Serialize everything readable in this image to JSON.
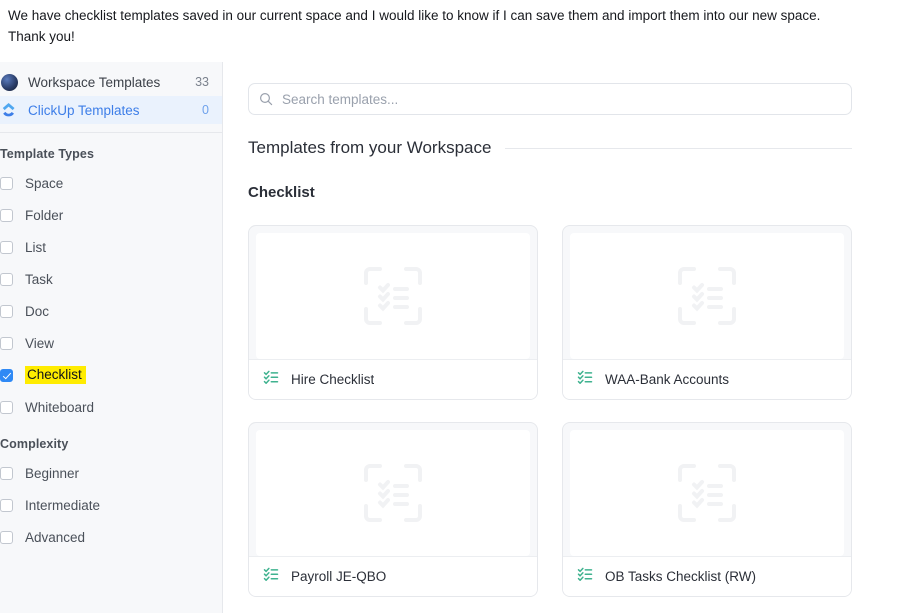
{
  "intro": {
    "line1": "We have checklist templates saved in our current space and I would like to know if I can save them and import them into our new space.",
    "line2": "Thank you!"
  },
  "sidebar": {
    "nav": [
      {
        "label": "Workspace Templates",
        "count": "33",
        "icon": "avatar-icon",
        "active": false
      },
      {
        "label": "ClickUp Templates",
        "count": "0",
        "icon": "clickup-logo-icon",
        "active": true
      }
    ],
    "sections": [
      {
        "title": "Template Types",
        "options": [
          {
            "label": "Space",
            "checked": false,
            "highlighted": false
          },
          {
            "label": "Folder",
            "checked": false,
            "highlighted": false
          },
          {
            "label": "List",
            "checked": false,
            "highlighted": false
          },
          {
            "label": "Task",
            "checked": false,
            "highlighted": false
          },
          {
            "label": "Doc",
            "checked": false,
            "highlighted": false
          },
          {
            "label": "View",
            "checked": false,
            "highlighted": false
          },
          {
            "label": "Checklist",
            "checked": true,
            "highlighted": true
          },
          {
            "label": "Whiteboard",
            "checked": false,
            "highlighted": false
          }
        ]
      },
      {
        "title": "Complexity",
        "options": [
          {
            "label": "Beginner",
            "checked": false,
            "highlighted": false
          },
          {
            "label": "Intermediate",
            "checked": false,
            "highlighted": false
          },
          {
            "label": "Advanced",
            "checked": false,
            "highlighted": false
          }
        ]
      }
    ]
  },
  "main": {
    "search": {
      "value": "",
      "placeholder": "Search templates..."
    },
    "workspace_section_title": "Templates from your Workspace",
    "category_title": "Checklist",
    "cards": [
      {
        "name": "Hire Checklist"
      },
      {
        "name": "WAA-Bank Accounts"
      },
      {
        "name": "Payroll JE-QBO"
      },
      {
        "name": "OB Tasks Checklist (RW)"
      }
    ]
  },
  "colors": {
    "accent_blue": "#2f89f5",
    "active_blue": "#3d7ee8",
    "highlight_yellow": "#ffec00",
    "checklist_green": "#3fb28f",
    "sidebar_bg": "#f7f8fa"
  }
}
